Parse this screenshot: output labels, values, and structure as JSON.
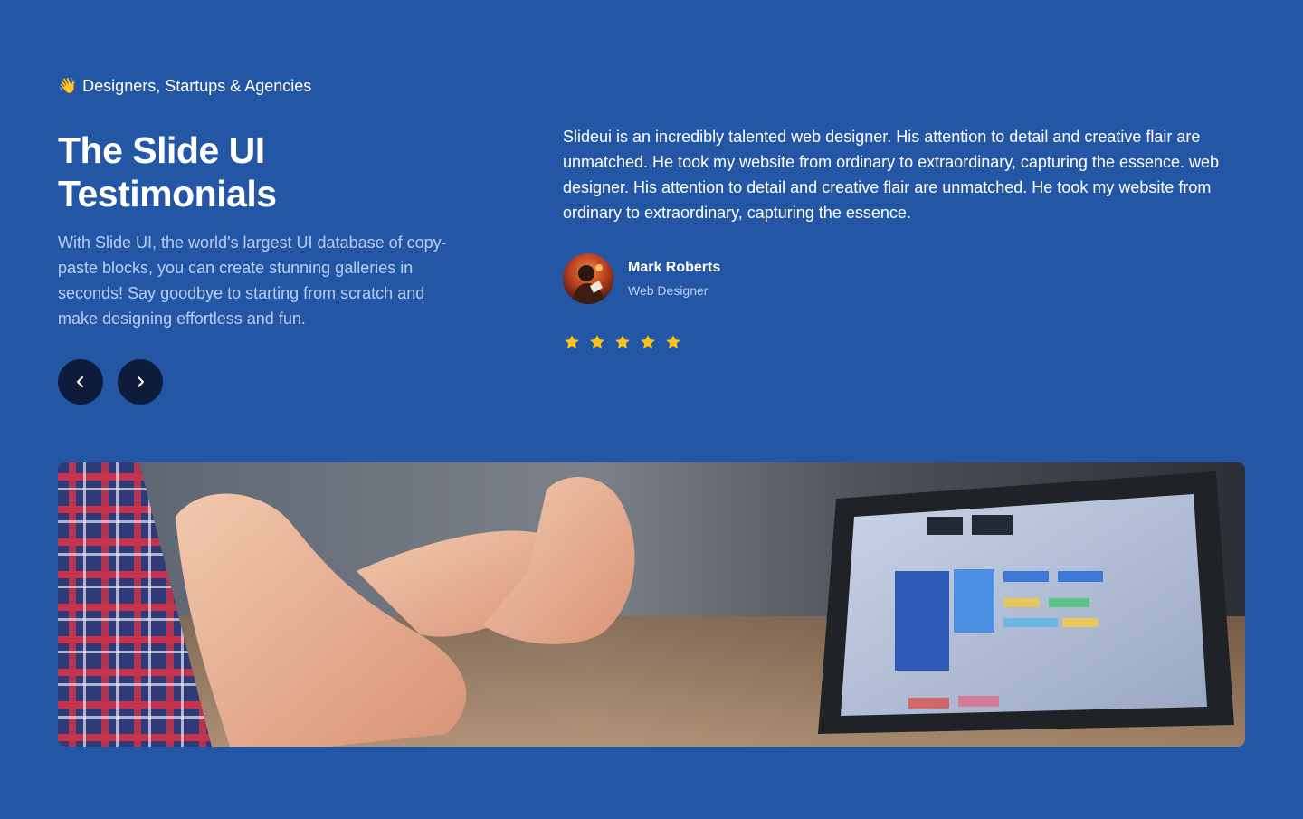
{
  "colors": {
    "background": "#2456a6",
    "button_bg": "#0f1b3a",
    "muted_text": "#b9cdf2",
    "star": "#f5c518"
  },
  "eyebrow": {
    "icon": "waving-hand-icon",
    "emoji": "👋",
    "text": "Designers, Startups & Agencies"
  },
  "heading": {
    "line1": "The Slide UI",
    "line2": "Testimonials"
  },
  "description": "With Slide UI, the world's largest UI database of copy-paste blocks, you can create stunning galleries in seconds! Say goodbye to starting from scratch and make designing effortless and fun.",
  "navigation": {
    "prev_icon": "chevron-left-icon",
    "next_icon": "chevron-right-icon"
  },
  "testimonial": {
    "quote": "Slideui is an incredibly talented web designer. His attention to detail and creative flair are unmatched. He took my website from ordinary to extraordinary, capturing the essence. web designer. His attention to detail and creative flair are unmatched. He took my website from ordinary to extraordinary, capturing the essence.",
    "author_name": "Mark Roberts",
    "author_role": "Web Designer",
    "rating": 5,
    "rating_max": 5
  },
  "hero_image": {
    "subject": "people-gesturing-at-laptop-photo"
  }
}
